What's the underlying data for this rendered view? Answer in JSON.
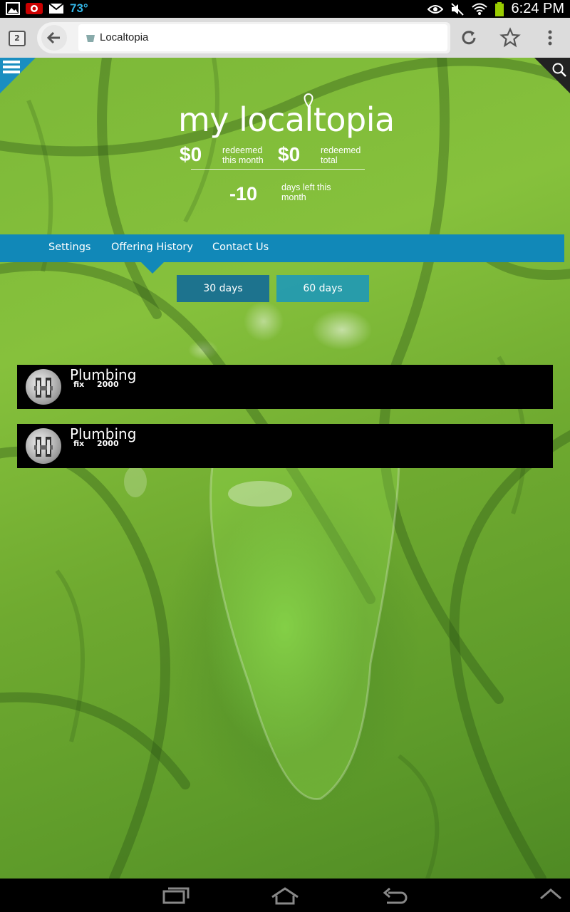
{
  "status_bar": {
    "temperature": "73°",
    "time": "6:24 PM",
    "icons": [
      "gallery-icon",
      "vodafone-icon",
      "gmail-icon",
      "eye-icon",
      "mute-icon",
      "wifi-icon",
      "battery-icon"
    ]
  },
  "browser": {
    "tab_count": "2",
    "url_title": "Localtopia"
  },
  "app": {
    "brand": "my localtopia",
    "stats": {
      "redeemed_month_amount": "$0",
      "redeemed_month_label_1": "redeemed",
      "redeemed_month_label_2": "this month",
      "redeemed_total_amount": "$0",
      "redeemed_total_label_1": "redeemed",
      "redeemed_total_label_2": "total",
      "days_left_value": "-10",
      "days_left_label_1": "days left this",
      "days_left_label_2": "month"
    },
    "nav": {
      "settings": "Settings",
      "offering_history": "Offering History",
      "contact_us": "Contact Us",
      "active": "Offering History"
    },
    "range_buttons": {
      "b30": "30 days",
      "b60": "60 days"
    },
    "offerings": [
      {
        "title": "Plumbing",
        "tag": "fix",
        "value": "2000"
      },
      {
        "title": "Plumbing",
        "tag": "fix",
        "value": "2000"
      }
    ]
  },
  "colors": {
    "accent": "#1188b8",
    "status_temp": "#33b5e5",
    "card_bg": "#000000"
  }
}
